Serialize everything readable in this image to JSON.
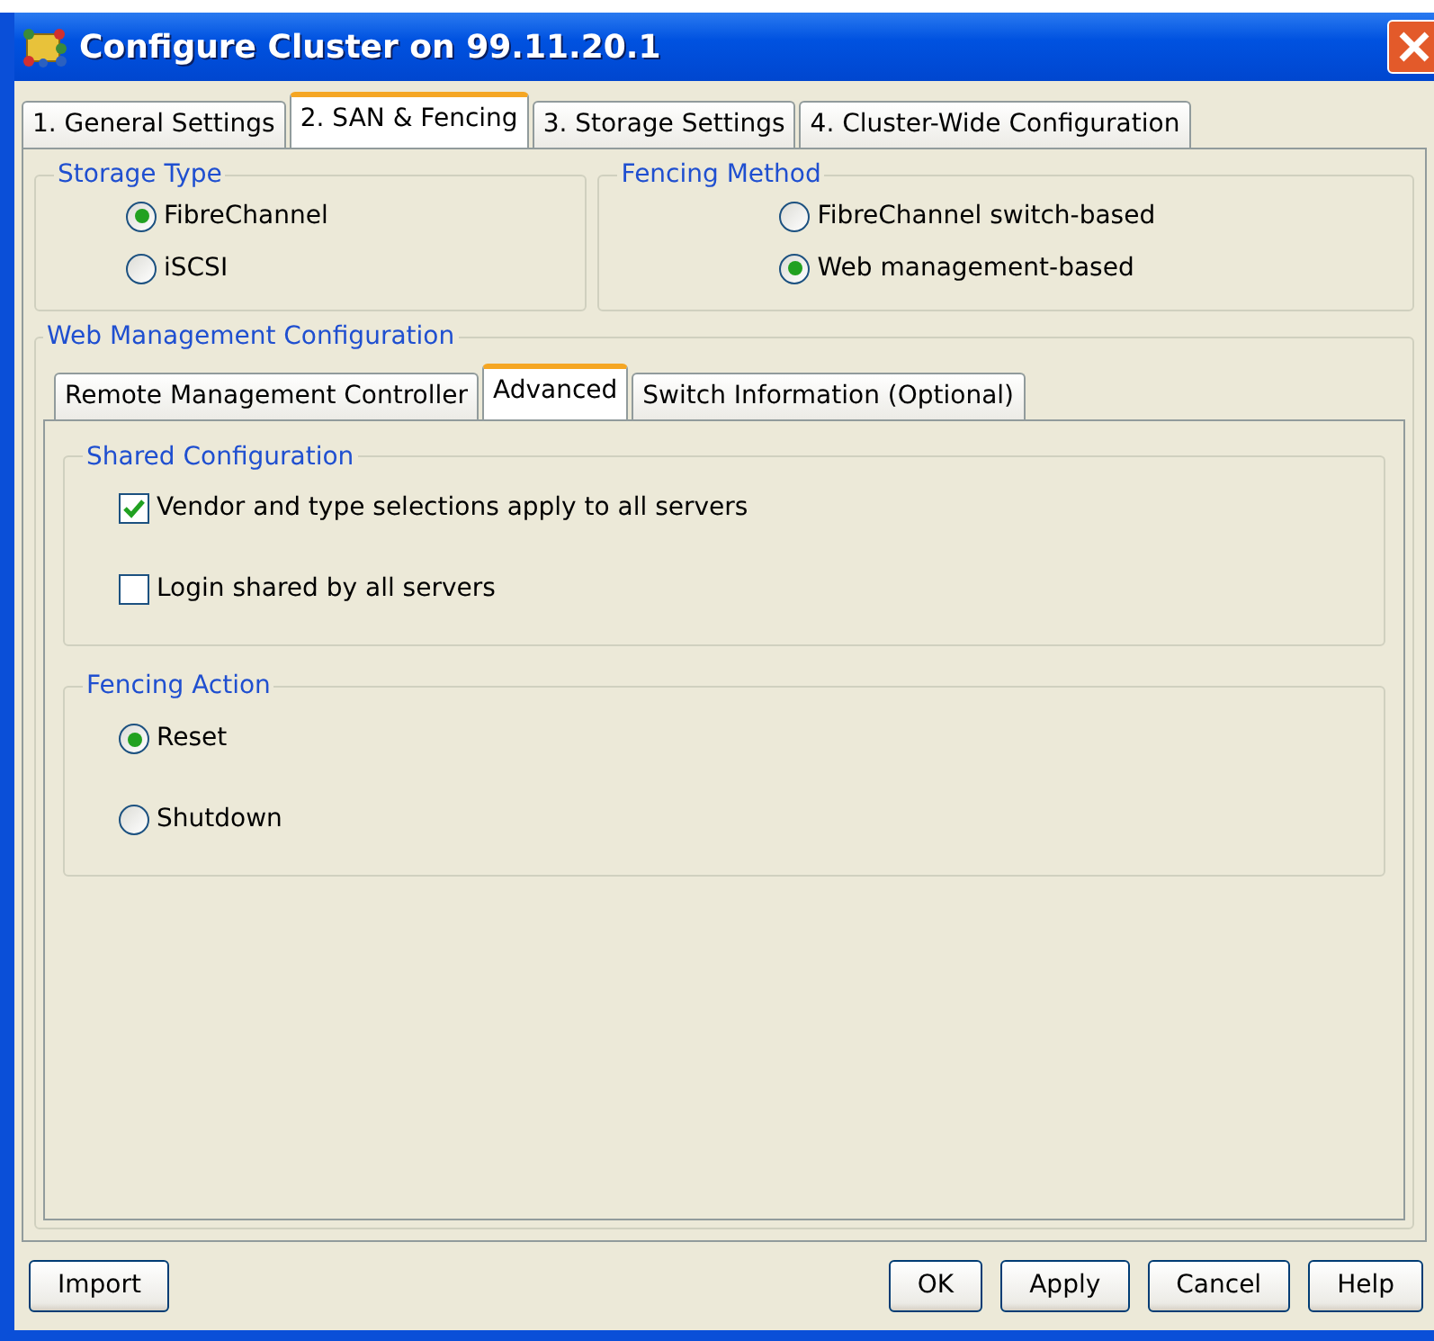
{
  "window": {
    "title": "Configure Cluster on 99.11.20.1"
  },
  "tabs": [
    {
      "label": "1. General Settings",
      "selected": false
    },
    {
      "label": "2. SAN & Fencing",
      "selected": true
    },
    {
      "label": "3. Storage Settings",
      "selected": false
    },
    {
      "label": "4. Cluster-Wide Configuration",
      "selected": false
    }
  ],
  "storage_type": {
    "title": "Storage Type",
    "options": [
      {
        "label": "FibreChannel",
        "selected": true
      },
      {
        "label": "iSCSI",
        "selected": false
      }
    ]
  },
  "fencing_method": {
    "title": "Fencing Method",
    "options": [
      {
        "label": "FibreChannel switch-based",
        "selected": false
      },
      {
        "label": "Web management-based",
        "selected": true
      }
    ]
  },
  "web_management": {
    "title": "Web Management Configuration",
    "tabs": [
      {
        "label": "Remote Management Controller",
        "selected": false
      },
      {
        "label": "Advanced",
        "selected": true
      },
      {
        "label": "Switch Information (Optional)",
        "selected": false
      }
    ],
    "groups": [
      {
        "title": "Shared Configuration",
        "kind": "checkboxes",
        "items": [
          {
            "label": "Vendor and type selections apply to all servers",
            "checked": true
          },
          {
            "label": "Login shared by all servers",
            "checked": false
          }
        ]
      },
      {
        "title": "Fencing Action",
        "kind": "radios",
        "items": [
          {
            "label": "Reset",
            "selected": true
          },
          {
            "label": "Shutdown",
            "selected": false
          }
        ]
      }
    ]
  },
  "buttons_left": [
    "Import"
  ],
  "buttons_right": [
    "OK",
    "Apply",
    "Cancel",
    "Help"
  ]
}
